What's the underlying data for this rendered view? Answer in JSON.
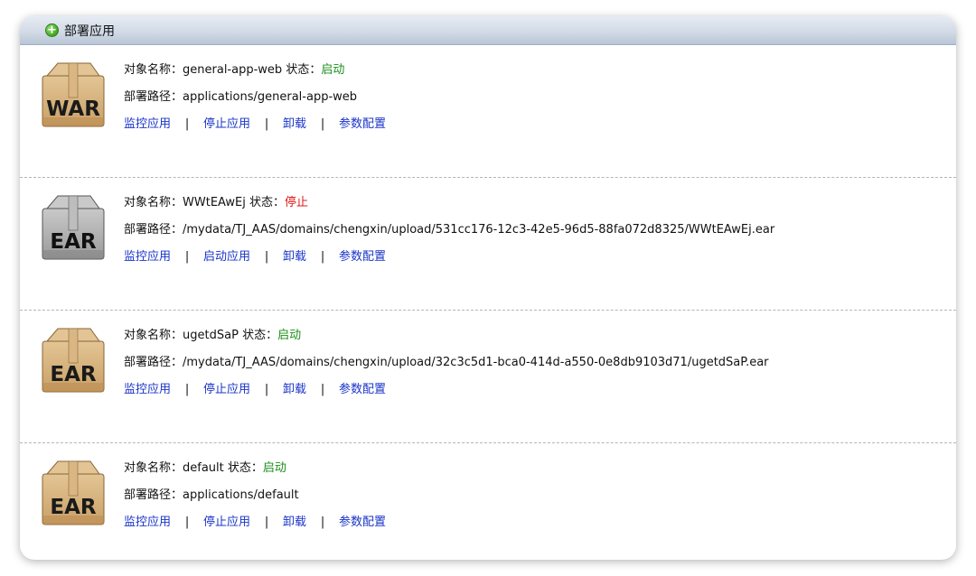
{
  "header": {
    "title": "部署应用"
  },
  "labels": {
    "name": "对象名称：",
    "status": "状态：",
    "path": "部署路径：",
    "sep": "|"
  },
  "apps": [
    {
      "type": "WAR",
      "variant": "tan",
      "name": "general-app-web",
      "status": "启动",
      "status_kind": "on",
      "path": "applications/general-app-web",
      "actions": [
        "监控应用",
        "停止应用",
        "卸载",
        "参数配置"
      ]
    },
    {
      "type": "EAR",
      "variant": "gray",
      "name": "WWtEAwEj",
      "status": "停止",
      "status_kind": "off",
      "path": "/mydata/TJ_AAS/domains/chengxin/upload/531cc176-12c3-42e5-96d5-88fa072d8325/WWtEAwEj.ear",
      "actions": [
        "监控应用",
        "启动应用",
        "卸载",
        "参数配置"
      ]
    },
    {
      "type": "EAR",
      "variant": "tan",
      "name": "ugetdSaP",
      "status": "启动",
      "status_kind": "on",
      "path": "/mydata/TJ_AAS/domains/chengxin/upload/32c3c5d1-bca0-414d-a550-0e8db9103d71/ugetdSaP.ear",
      "actions": [
        "监控应用",
        "停止应用",
        "卸载",
        "参数配置"
      ]
    },
    {
      "type": "EAR",
      "variant": "tan",
      "name": "default",
      "status": "启动",
      "status_kind": "on",
      "path": "applications/default",
      "actions": [
        "监控应用",
        "停止应用",
        "卸载",
        "参数配置"
      ]
    }
  ],
  "colors": {
    "status_on": "#1a8f1a",
    "status_off": "#e01818",
    "link": "#1a34c8",
    "box_tan": "#c9a066",
    "box_gray": "#9a9a9a"
  },
  "icons": {
    "header": "plus-circle-icon",
    "package": "package-box-icon"
  }
}
